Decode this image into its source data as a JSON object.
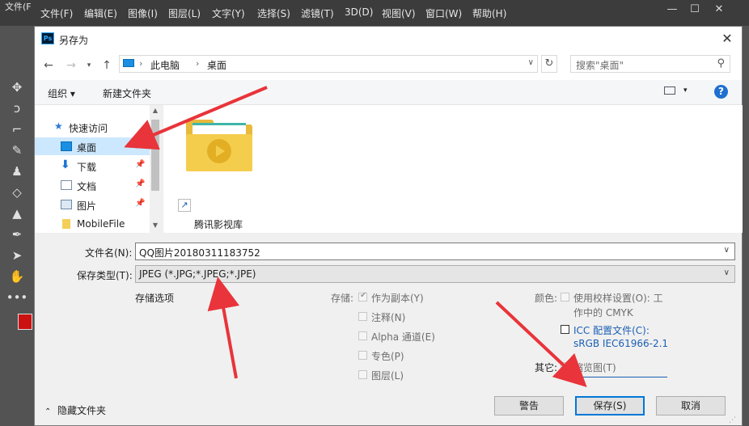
{
  "ps": {
    "menu": [
      "文件(F)",
      "编辑(E)",
      "图像(I)",
      "图层(L)",
      "文字(Y)",
      "选择(S)",
      "滤镜(T)",
      "3D(D)",
      "视图(V)",
      "窗口(W)",
      "帮助(H)"
    ],
    "file_tab": "文件(F",
    "win_min": "—",
    "win_max": "☐",
    "win_close": "✕",
    "tool_icons": [
      "move-icon",
      "lasso-icon",
      "crop-icon",
      "eyedropper-icon",
      "stamp-icon",
      "eraser-icon",
      "triangle-icon",
      "pen-icon",
      "select-arrow-icon",
      "hand-icon",
      "more-icon"
    ],
    "foreground_color": "#cc1111"
  },
  "dialog": {
    "title": "另存为",
    "app_badge": "Ps",
    "address": [
      "此电脑",
      "桌面"
    ],
    "search_placeholder": "搜索\"桌面\"",
    "organize": "组织 ▾",
    "new_folder": "新建文件夹",
    "help": "?"
  },
  "nav": {
    "quick_access": "快速访问",
    "items": [
      {
        "label": "桌面",
        "icon": "desktop-icon",
        "pinned": true,
        "selected": true
      },
      {
        "label": "下载",
        "icon": "download-icon",
        "pinned": true
      },
      {
        "label": "文档",
        "icon": "document-icon",
        "pinned": true
      },
      {
        "label": "图片",
        "icon": "pictures-icon",
        "pinned": true
      },
      {
        "label": "MobileFile",
        "icon": "folder-icon",
        "pinned": false
      }
    ]
  },
  "content": {
    "folder_label": "腾讯影视库"
  },
  "form": {
    "filename_label": "文件名(N):",
    "filename_value": "QQ图片20180311183752",
    "filetype_label": "保存类型(T):",
    "filetype_value": "JPEG (*.JPG;*.JPEG;*.JPE)",
    "save_options": "存储选项",
    "store_label": "存储:",
    "store_opts": [
      "作为副本(Y)",
      "注释(N)",
      "Alpha 通道(E)",
      "专色(P)",
      "图层(L)"
    ],
    "color_label": "颜色:",
    "proof_setup_1": "使用校样设置(O):  工",
    "proof_setup_2": "作中的 CMYK",
    "icc_1": "ICC 配置文件(C):",
    "icc_2": "sRGB IEC61966-2.1",
    "other_label": "其它:",
    "thumbnail": "缩览图(T)"
  },
  "footer": {
    "hide_folders": "隐藏文件夹",
    "warning": "警告",
    "save": "保存(S)",
    "cancel": "取消"
  },
  "colors": {
    "accent": "#0078d7",
    "arrow": "#e8343a",
    "selected_nav": "#cce8ff"
  }
}
